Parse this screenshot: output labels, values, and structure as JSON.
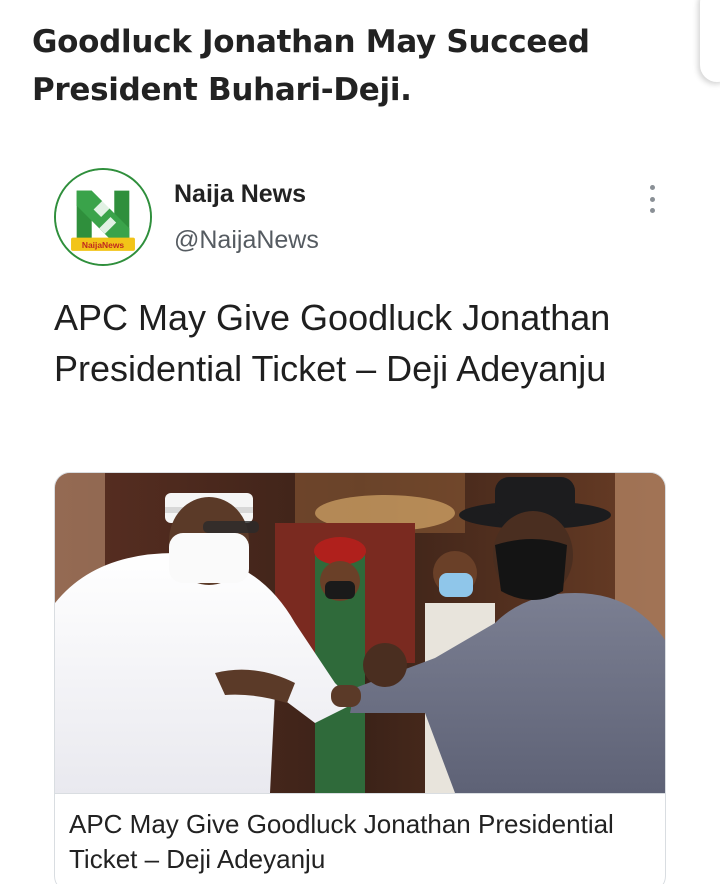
{
  "headline": "Goodluck Jonathan May Succeed President Buhari-Deji.",
  "tweet": {
    "display_name": "Naija News",
    "handle": "@NaijaNews",
    "avatar_icon": "naija-news-logo",
    "avatar_badge": "NaijaNews",
    "text": "APC May Give Goodluck Jonathan Presidential Ticket – Deji Adeyanju",
    "more_icon": "vertical-ellipsis-icon"
  },
  "card": {
    "title": "APC May Give Goodluck Jonathan Presidential Ticket – Deji Adeyanju"
  },
  "colors": {
    "brand_green": "#2f8f3c",
    "text_primary": "#222222",
    "text_secondary": "#555b61",
    "border": "#d9dde1"
  }
}
